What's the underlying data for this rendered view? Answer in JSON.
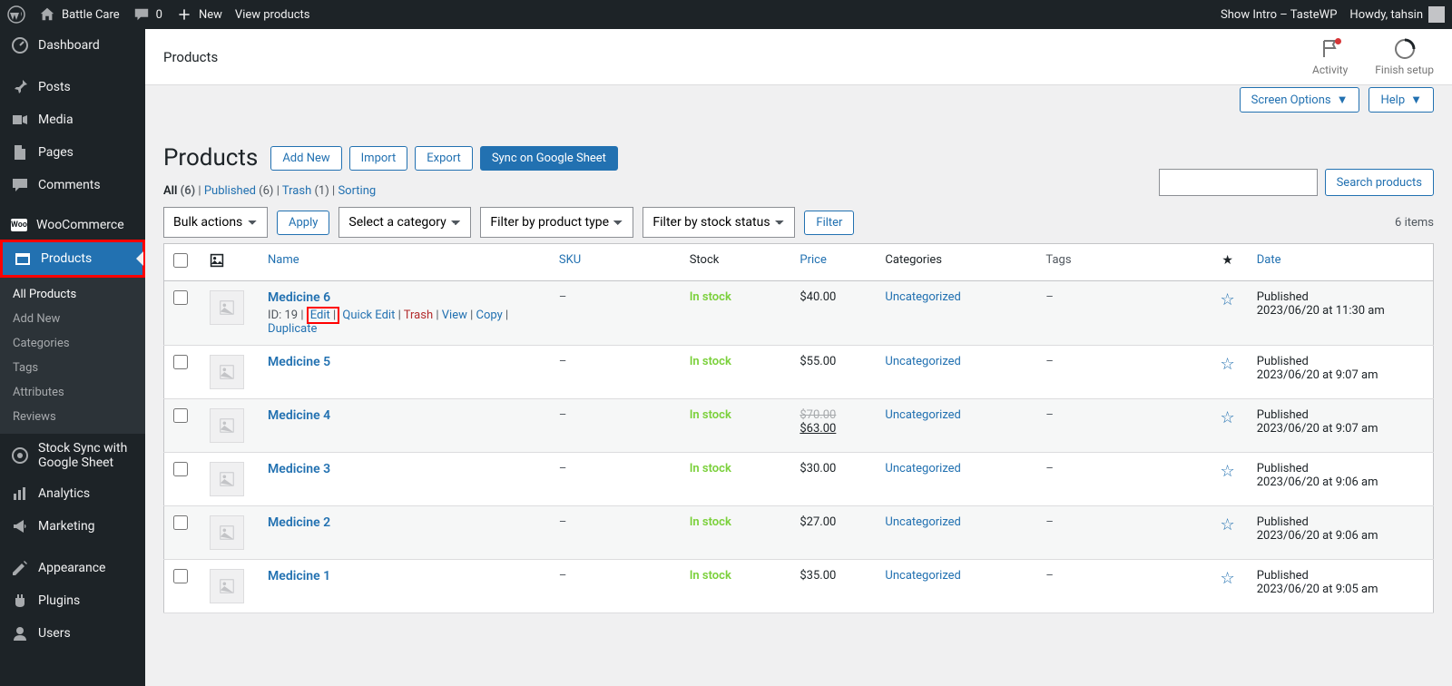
{
  "adminbar": {
    "site_name": "Battle Care",
    "comments_count": "0",
    "new_label": "New",
    "view_products": "View products",
    "show_intro": "Show Intro – TasteWP",
    "howdy": "Howdy, tahsin"
  },
  "sidebar": {
    "items": [
      {
        "label": "Dashboard"
      },
      {
        "label": "Posts"
      },
      {
        "label": "Media"
      },
      {
        "label": "Pages"
      },
      {
        "label": "Comments"
      },
      {
        "label": "WooCommerce"
      },
      {
        "label": "Products"
      },
      {
        "label": "Stock Sync with Google Sheet"
      },
      {
        "label": "Analytics"
      },
      {
        "label": "Marketing"
      },
      {
        "label": "Appearance"
      },
      {
        "label": "Plugins"
      },
      {
        "label": "Users"
      }
    ],
    "submenu": [
      {
        "label": "All Products"
      },
      {
        "label": "Add New"
      },
      {
        "label": "Categories"
      },
      {
        "label": "Tags"
      },
      {
        "label": "Attributes"
      },
      {
        "label": "Reviews"
      }
    ]
  },
  "topbar": {
    "breadcrumb": "Products",
    "activity": "Activity",
    "finish_setup": "Finish setup"
  },
  "screen_meta": {
    "screen_options": "Screen Options",
    "help": "Help"
  },
  "page": {
    "title": "Products",
    "add_new": "Add New",
    "import": "Import",
    "export": "Export",
    "sync": "Sync on Google Sheet"
  },
  "views": {
    "all_label": "All",
    "all_count": "(6)",
    "published_label": "Published",
    "published_count": "(6)",
    "trash_label": "Trash",
    "trash_count": "(1)",
    "sorting_label": "Sorting"
  },
  "search": {
    "button": "Search products"
  },
  "filters": {
    "bulk": "Bulk actions",
    "apply": "Apply",
    "category": "Select a category",
    "product_type": "Filter by product type",
    "stock_status": "Filter by stock status",
    "filter_btn": "Filter",
    "count": "6 items"
  },
  "columns": {
    "name": "Name",
    "sku": "SKU",
    "stock": "Stock",
    "price": "Price",
    "categories": "Categories",
    "tags": "Tags",
    "date": "Date"
  },
  "row_actions": {
    "id_prefix": "ID: 19",
    "edit": "Edit",
    "quick_edit": "Quick Edit",
    "trash": "Trash",
    "view": "View",
    "copy": "Copy",
    "duplicate": "Duplicate"
  },
  "products": [
    {
      "name": "Medicine 6",
      "sku": "–",
      "stock": "In stock",
      "price": "$40.00",
      "sale": "",
      "cat": "Uncategorized",
      "tags": "–",
      "pub": "Published",
      "date": "2023/06/20 at 11:30 am",
      "hover": true
    },
    {
      "name": "Medicine 5",
      "sku": "–",
      "stock": "In stock",
      "price": "$55.00",
      "sale": "",
      "cat": "Uncategorized",
      "tags": "–",
      "pub": "Published",
      "date": "2023/06/20 at 9:07 am"
    },
    {
      "name": "Medicine 4",
      "sku": "–",
      "stock": "In stock",
      "price": "$70.00",
      "sale": "$63.00",
      "cat": "Uncategorized",
      "tags": "–",
      "pub": "Published",
      "date": "2023/06/20 at 9:07 am"
    },
    {
      "name": "Medicine 3",
      "sku": "–",
      "stock": "In stock",
      "price": "$30.00",
      "sale": "",
      "cat": "Uncategorized",
      "tags": "–",
      "pub": "Published",
      "date": "2023/06/20 at 9:06 am"
    },
    {
      "name": "Medicine 2",
      "sku": "–",
      "stock": "In stock",
      "price": "$27.00",
      "sale": "",
      "cat": "Uncategorized",
      "tags": "–",
      "pub": "Published",
      "date": "2023/06/20 at 9:06 am"
    },
    {
      "name": "Medicine 1",
      "sku": "–",
      "stock": "In stock",
      "price": "$35.00",
      "sale": "",
      "cat": "Uncategorized",
      "tags": "–",
      "pub": "Published",
      "date": "2023/06/20 at 9:05 am"
    }
  ]
}
